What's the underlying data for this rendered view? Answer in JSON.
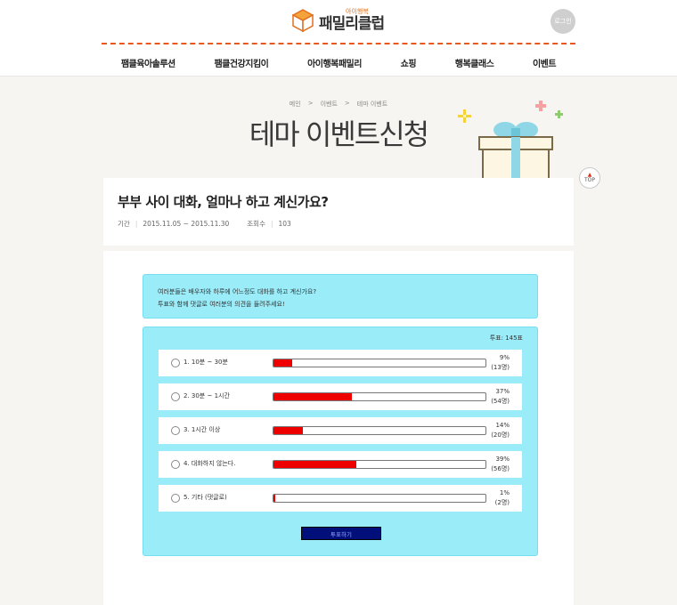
{
  "header": {
    "logo_sub": "아이행복",
    "logo_main": "패밀리클럽",
    "login_label": "로그인",
    "nav": [
      "팸클육아솔루션",
      "팸클건강지킴이",
      "아이행복패밀리",
      "쇼핑",
      "행복클래스",
      "이벤트"
    ]
  },
  "breadcrumb": [
    "메인",
    ">",
    "이벤트",
    ">",
    "테마 이벤트"
  ],
  "page_title": "테마 이벤트신청",
  "top_button": {
    "arrow": "▲",
    "label": "TOP"
  },
  "event": {
    "title": "부부 사이 대화, 얼마나 하고 계신가요?",
    "period_label": "기간",
    "period_value": "2015.11.05 ~ 2015.11.30",
    "views_label": "조회수",
    "views_value": "103"
  },
  "prompt": {
    "line1": "여러분들은 배우자와 하루에 어느정도 대화를 하고 계신가요?",
    "line2": "투표와 함께 댓글로 여러분의 의견을 들려주세요!"
  },
  "poll": {
    "total": "투표: 145표",
    "bar_color": "#ee0000",
    "options": [
      {
        "label": "1. 10분 ~ 30분",
        "percent": "9%",
        "count": "(13명)",
        "fill": 9
      },
      {
        "label": "2. 30분 ~ 1시간",
        "percent": "37%",
        "count": "(54명)",
        "fill": 37
      },
      {
        "label": "3. 1시간 이상",
        "percent": "14%",
        "count": "(20명)",
        "fill": 14
      },
      {
        "label": "4. 대화하지 않는다.",
        "percent": "39%",
        "count": "(56명)",
        "fill": 39
      },
      {
        "label": "5. 기타 (댓글로)",
        "percent": "1%",
        "count": "(2명)",
        "fill": 1
      }
    ],
    "vote_label": "투표하기"
  }
}
